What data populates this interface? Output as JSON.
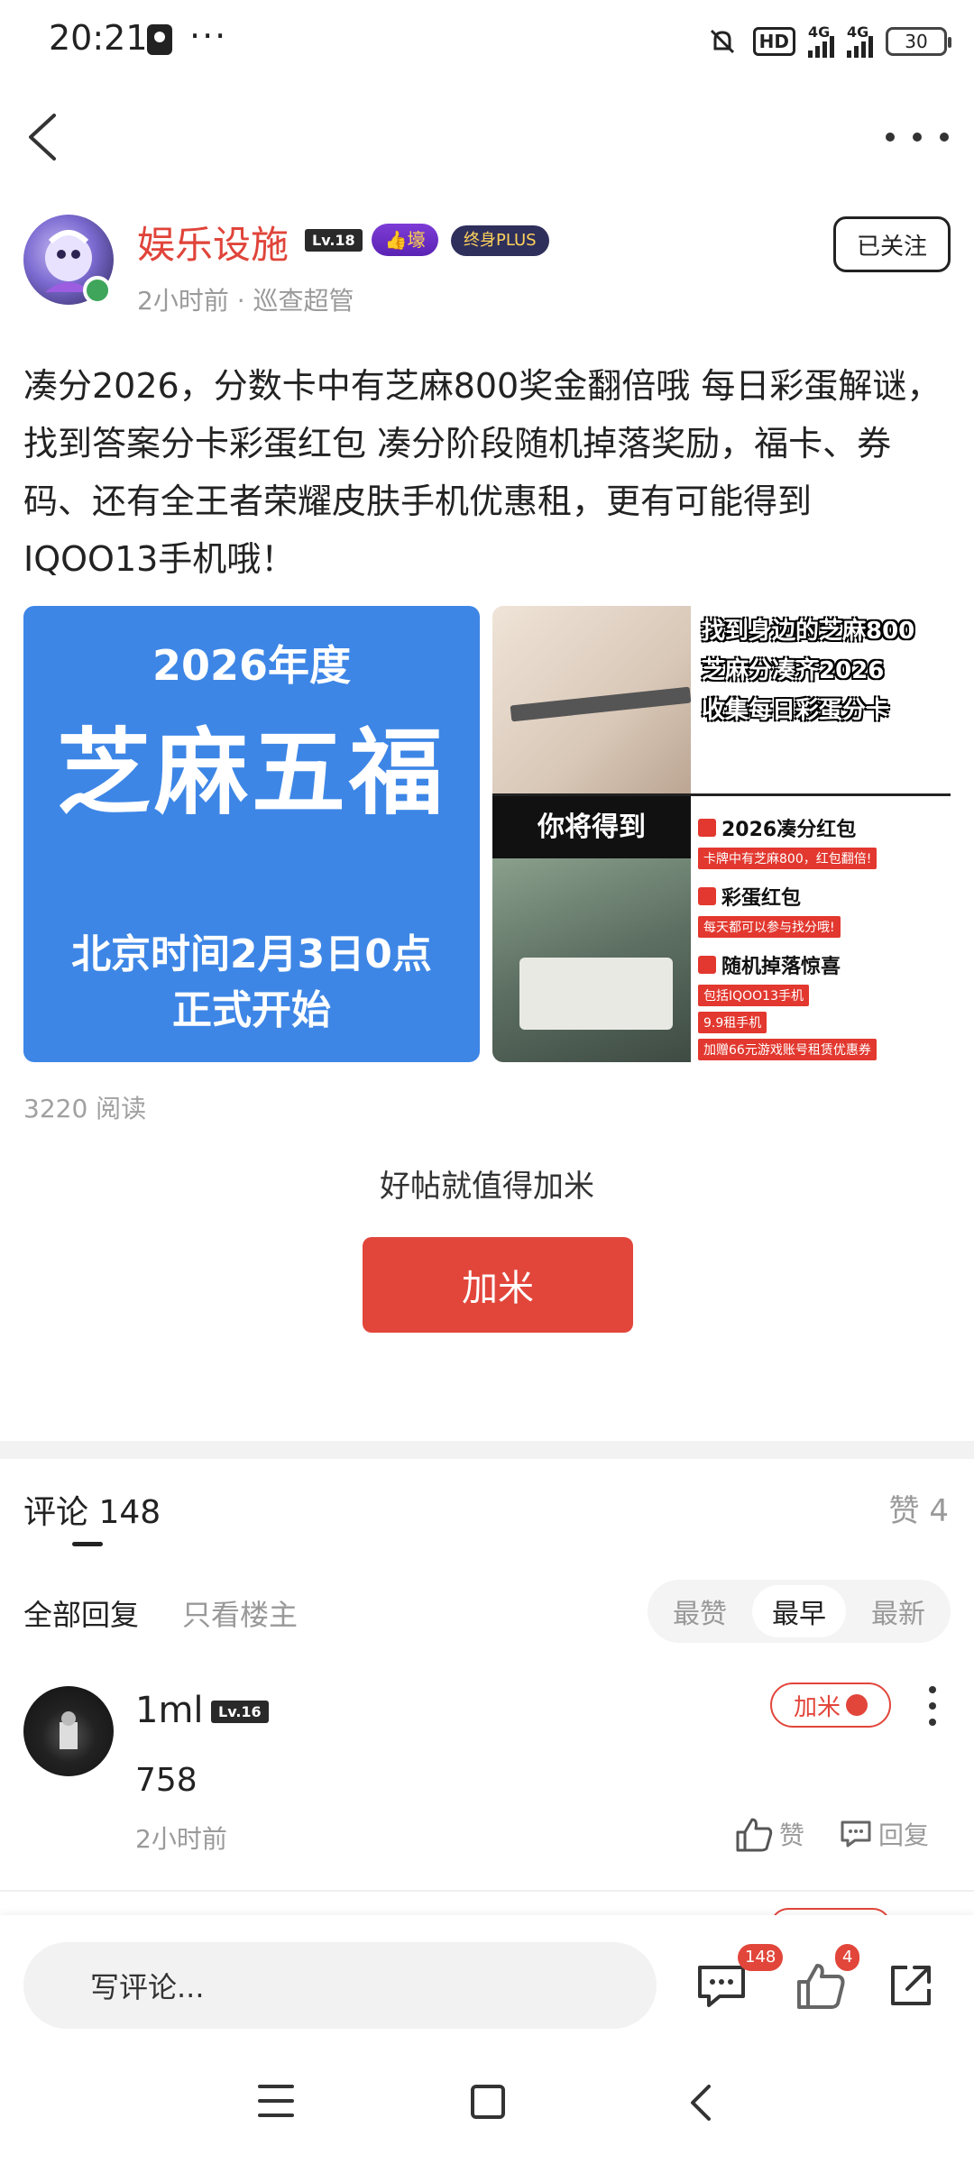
{
  "status_bar": {
    "time": "20:21",
    "dots": "···",
    "hd_label": "HD",
    "net1": "4G",
    "net2": "4G",
    "battery": "30"
  },
  "author": {
    "name": "娱乐设施",
    "level": "Lv.18",
    "title_badge": "👍壕",
    "plus_badge": "终身PLUS",
    "meta": "2小时前 · 巡查超管",
    "follow_label": "已关注"
  },
  "post": {
    "text": "凑分2026，分数卡中有芝麻800奖金翻倍哦 每日彩蛋解谜，找到答案分卡彩蛋红包 凑分阶段随机掉落奖励，福卡、券码、还有全王者荣耀皮肤手机优惠租，更有可能得到IQOO13手机哦！",
    "read_count": "3220 阅读"
  },
  "image_left": {
    "year": "2026年度",
    "headline": "芝麻五福",
    "time_line1": "北京时间2月3日0点",
    "time_line2": "正式开始"
  },
  "image_right": {
    "top_line1": "找到身边的芝麻800",
    "top_line2": "芝麻分凑齐2026",
    "top_line3": "收集每日彩蛋分卡",
    "black_label": "你将得到",
    "item1_title": "2026凑分红包",
    "item1_tag": "卡牌中有芝麻800，红包翻倍!",
    "item2_title": "彩蛋红包",
    "item2_tag": "每天都可以参与找分哦!",
    "item3_title": "随机掉落惊喜",
    "item3_tag1": "包括IQOO13手机",
    "item3_tag2": "9.9租手机",
    "item3_tag3": "加赠66元游戏账号租赁优惠券"
  },
  "reward": {
    "hint": "好帖就值得加米",
    "button": "加米"
  },
  "comments_header": {
    "title": "评论 148",
    "likes": "赞 4",
    "filter_all": "全部回复",
    "filter_host": "只看楼主",
    "sort_options": [
      "最赞",
      "最早",
      "最新"
    ],
    "sort_active": "最早"
  },
  "comment": {
    "user": "1ml",
    "level": "Lv.16",
    "reward_label": "加米",
    "body": "758",
    "time": "2小时前",
    "like_label": "赞",
    "reply_label": "回复"
  },
  "bottom_bar": {
    "input_placeholder": "写评论...",
    "comment_count": "148",
    "like_count": "4"
  },
  "colors": {
    "accent_red": "#e2463b",
    "author_name": "#e0443a",
    "blue_card": "#3d86e6"
  }
}
